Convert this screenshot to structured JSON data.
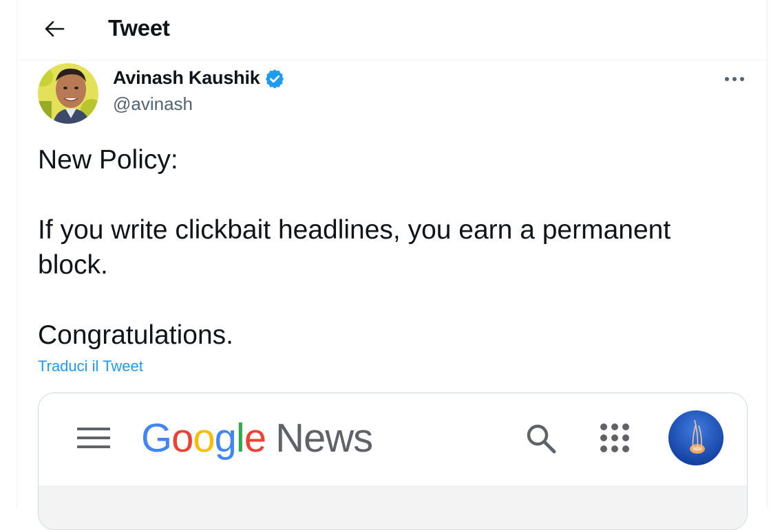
{
  "header": {
    "title": "Tweet",
    "back_icon": "arrow-left-icon"
  },
  "author": {
    "name": "Avinash Kaushik",
    "handle": "@avinash",
    "verified": true,
    "verified_color": "#1d9bf0"
  },
  "tweet": {
    "text": "New Policy:\n\nIf you write clickbait headlines, you earn a permanent block.\n\nCongratulations.",
    "translate_label": "Traduci il Tweet",
    "more_icon": "more-horizontal-icon"
  },
  "media": {
    "logo_brand": "Google",
    "logo_product": "News",
    "logo_letters": [
      {
        "char": "G",
        "color": "#4285f4"
      },
      {
        "char": "o",
        "color": "#ea4335"
      },
      {
        "char": "o",
        "color": "#fbbc05"
      },
      {
        "char": "g",
        "color": "#4285f4"
      },
      {
        "char": "l",
        "color": "#34a853"
      },
      {
        "char": "e",
        "color": "#ea4335"
      }
    ],
    "icons": [
      "hamburger-menu-icon",
      "search-icon",
      "apps-grid-icon",
      "account-avatar"
    ]
  },
  "colors": {
    "accent": "#1d9bf0",
    "text_primary": "#0f1419",
    "text_secondary": "#536471",
    "border": "#eff3f4"
  }
}
